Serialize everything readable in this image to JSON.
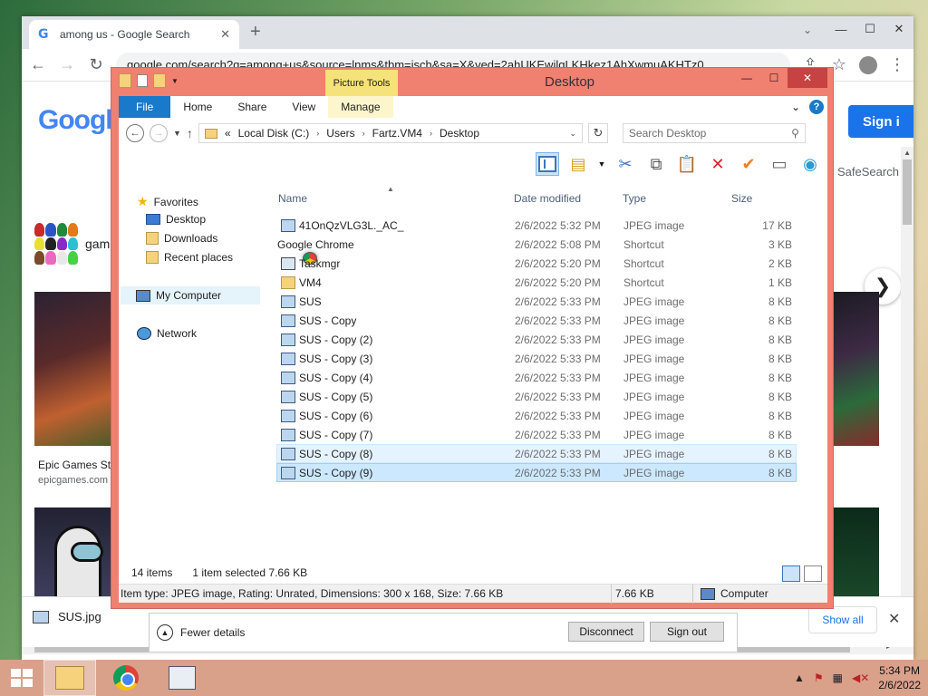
{
  "chrome": {
    "tab_title": "among us - Google Search",
    "tab_close": "✕",
    "new_tab": "+",
    "tab_menu": "⌄",
    "win_min": "—",
    "win_max": "☐",
    "win_close": "✕",
    "back": "←",
    "forward": "→",
    "reload": "↻",
    "url": "google.com/search?q=among+us&source=lnms&tbm=isch&sa=X&ved=2ahUKEwilqLKHkez1AhXwmuAKHTz0",
    "share": "⇪",
    "bookmark": "☆",
    "menu": "⋮"
  },
  "google": {
    "logo": "Googl",
    "sign_in": "Sign i",
    "safesearch": "SafeSearch",
    "chip_label": "gam",
    "next": "❯",
    "result_caption": "Epic Games St",
    "result_site": "epicgames.com"
  },
  "downloads": {
    "file_name": "SUS.jpg",
    "show_all": "Show all",
    "close": "✕"
  },
  "rdp": {
    "fewer_details": "Fewer details",
    "disconnect": "Disconnect",
    "sign_out": "Sign out"
  },
  "explorer": {
    "title": "Desktop",
    "picture_tools": "Picture Tools",
    "win_min": "—",
    "win_max": "☐",
    "win_close": "✕",
    "ribbon_tabs": {
      "file": "File",
      "home": "Home",
      "share": "Share",
      "view": "View",
      "manage": "Manage"
    },
    "ribbon_expand": "⌄",
    "help": "?",
    "address": {
      "overflow": "«",
      "crumbs": [
        "Local Disk (C:)",
        "Users",
        "Fartz.VM4",
        "Desktop"
      ],
      "separator": "›",
      "dropdown": "⌄"
    },
    "search_placeholder": "Search Desktop",
    "nav": {
      "favorites": "Favorites",
      "desktop": "Desktop",
      "downloads": "Downloads",
      "recent": "Recent places",
      "computer": "My Computer",
      "network": "Network"
    },
    "columns": {
      "name": "Name",
      "date": "Date modified",
      "type": "Type",
      "size": "Size"
    },
    "files": [
      {
        "name": "41OnQzVLG3L._AC_",
        "date": "2/6/2022 5:32 PM",
        "type": "JPEG image",
        "size": "17 KB",
        "icon": "image"
      },
      {
        "name": "Google Chrome",
        "date": "2/6/2022 5:08 PM",
        "type": "Shortcut",
        "size": "3 KB",
        "icon": "chrome"
      },
      {
        "name": "Taskmgr",
        "date": "2/6/2022 5:20 PM",
        "type": "Shortcut",
        "size": "2 KB",
        "icon": "taskmgr"
      },
      {
        "name": "VM4",
        "date": "2/6/2022 5:20 PM",
        "type": "Shortcut",
        "size": "1 KB",
        "icon": "folder"
      },
      {
        "name": "SUS",
        "date": "2/6/2022 5:33 PM",
        "type": "JPEG image",
        "size": "8 KB",
        "icon": "image"
      },
      {
        "name": "SUS - Copy",
        "date": "2/6/2022 5:33 PM",
        "type": "JPEG image",
        "size": "8 KB",
        "icon": "image"
      },
      {
        "name": "SUS - Copy (2)",
        "date": "2/6/2022 5:33 PM",
        "type": "JPEG image",
        "size": "8 KB",
        "icon": "image"
      },
      {
        "name": "SUS - Copy (3)",
        "date": "2/6/2022 5:33 PM",
        "type": "JPEG image",
        "size": "8 KB",
        "icon": "image"
      },
      {
        "name": "SUS - Copy (4)",
        "date": "2/6/2022 5:33 PM",
        "type": "JPEG image",
        "size": "8 KB",
        "icon": "image"
      },
      {
        "name": "SUS - Copy (5)",
        "date": "2/6/2022 5:33 PM",
        "type": "JPEG image",
        "size": "8 KB",
        "icon": "image"
      },
      {
        "name": "SUS - Copy (6)",
        "date": "2/6/2022 5:33 PM",
        "type": "JPEG image",
        "size": "8 KB",
        "icon": "image"
      },
      {
        "name": "SUS - Copy (7)",
        "date": "2/6/2022 5:33 PM",
        "type": "JPEG image",
        "size": "8 KB",
        "icon": "image"
      },
      {
        "name": "SUS - Copy (8)",
        "date": "2/6/2022 5:33 PM",
        "type": "JPEG image",
        "size": "8 KB",
        "icon": "image"
      },
      {
        "name": "SUS - Copy (9)",
        "date": "2/6/2022 5:33 PM",
        "type": "JPEG image",
        "size": "8 KB",
        "icon": "image"
      }
    ],
    "status": {
      "count": "14 items",
      "selected": "1 item selected  7.66 KB"
    },
    "details_bar": {
      "info": "Item type: JPEG image, Rating: Unrated, Dimensions: 300 x 168, Size: 7.66 KB",
      "size": "7.66 KB",
      "location": "Computer"
    }
  },
  "taskbar": {
    "time": "5:34 PM",
    "date": "2/6/2022",
    "tray_arrow": "▲"
  },
  "colors": {
    "explorer_frame": "#f08070",
    "ribbon_file": "#1979ca",
    "picture_tools": "#f6e27a",
    "taskbar": "#d9a08a",
    "selection": "#cce8ff"
  }
}
